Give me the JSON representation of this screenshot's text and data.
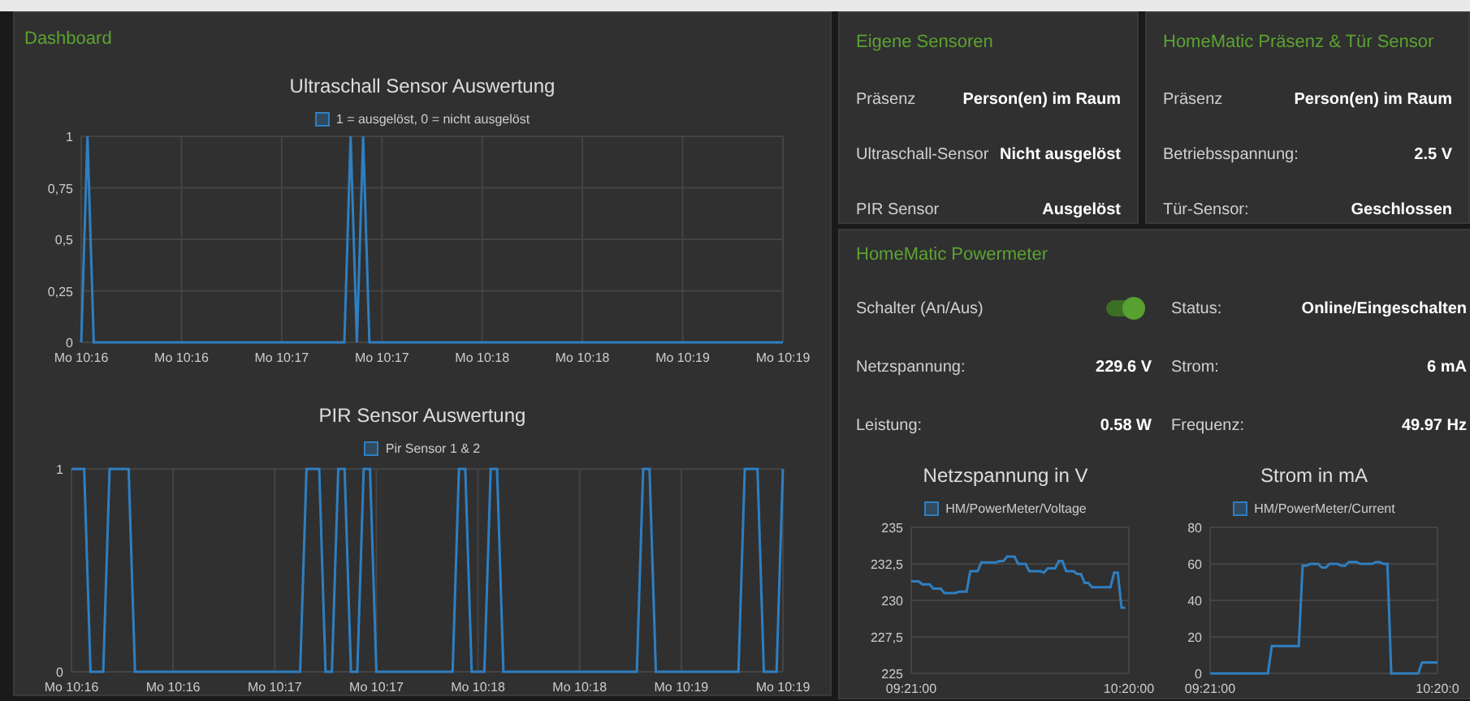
{
  "dashboard": {
    "title": "Dashboard",
    "charts": [
      {
        "chart_data": {
          "type": "line",
          "title": "Ultraschall Sensor Auswertung",
          "grid": true,
          "categories": [
            "Mo 10:16",
            null,
            null,
            null,
            null,
            null,
            null,
            null,
            null,
            null,
            null,
            null,
            null,
            null,
            null,
            null,
            "Mo 10:16",
            null,
            null,
            null,
            null,
            null,
            null,
            null,
            null,
            null,
            null,
            null,
            null,
            null,
            null,
            null,
            "Mo 10:17",
            null,
            null,
            null,
            null,
            null,
            null,
            null,
            null,
            null,
            null,
            null,
            null,
            null,
            null,
            null,
            "Mo 10:17",
            null,
            null,
            null,
            null,
            null,
            null,
            null,
            null,
            null,
            null,
            null,
            null,
            null,
            null,
            null,
            "Mo 10:18",
            null,
            null,
            null,
            null,
            null,
            null,
            null,
            null,
            null,
            null,
            null,
            null,
            null,
            null,
            null,
            "Mo 10:18",
            null,
            null,
            null,
            null,
            null,
            null,
            null,
            null,
            null,
            null,
            null,
            null,
            null,
            null,
            null,
            "Mo 10:19",
            null,
            null,
            null,
            null,
            null,
            null,
            null,
            null,
            null,
            null,
            null,
            null,
            null,
            null,
            null,
            "Mo 10:19"
          ],
          "series": [
            {
              "name": "1 = ausgelöst, 0 = nicht ausgelöst",
              "color": "#2f7fc1",
              "values": [
                0,
                1,
                0,
                0,
                0,
                0,
                0,
                0,
                0,
                0,
                0,
                0,
                0,
                0,
                0,
                0,
                0,
                0,
                0,
                0,
                0,
                0,
                0,
                0,
                0,
                0,
                0,
                0,
                0,
                0,
                0,
                0,
                0,
                0,
                0,
                0,
                0,
                0,
                0,
                0,
                0,
                0,
                0,
                1,
                0,
                1,
                0,
                0,
                0,
                0,
                0,
                0,
                0,
                0,
                0,
                0,
                0,
                0,
                0,
                0,
                0,
                0,
                0,
                0,
                0,
                0,
                0,
                0,
                0,
                0,
                0,
                0,
                0,
                0,
                0,
                0,
                0,
                0,
                0,
                0,
                0,
                0,
                0,
                0,
                0,
                0,
                0,
                0,
                0,
                0,
                0,
                0,
                0,
                0,
                0,
                0,
                0,
                0,
                0,
                0,
                0,
                0,
                0,
                0,
                0,
                0,
                0,
                0,
                0,
                0,
                0,
                0,
                0
              ]
            }
          ],
          "ylim": [
            0,
            1
          ],
          "yticks": [
            {
              "value": 0,
              "label": "0"
            },
            {
              "value": 0.25,
              "label": "0,25"
            },
            {
              "value": 0.5,
              "label": "0,5"
            },
            {
              "value": 0.75,
              "label": "0,75"
            },
            {
              "value": 1,
              "label": "1"
            }
          ]
        }
      },
      {
        "chart_data": {
          "type": "line",
          "title": "PIR Sensor Auswertung",
          "grid": true,
          "categories": [
            "Mo 10:16",
            null,
            null,
            null,
            null,
            null,
            null,
            null,
            null,
            null,
            null,
            null,
            null,
            null,
            null,
            null,
            "Mo 10:16",
            null,
            null,
            null,
            null,
            null,
            null,
            null,
            null,
            null,
            null,
            null,
            null,
            null,
            null,
            null,
            "Mo 10:17",
            null,
            null,
            null,
            null,
            null,
            null,
            null,
            null,
            null,
            null,
            null,
            null,
            null,
            null,
            null,
            "Mo 10:17",
            null,
            null,
            null,
            null,
            null,
            null,
            null,
            null,
            null,
            null,
            null,
            null,
            null,
            null,
            null,
            "Mo 10:18",
            null,
            null,
            null,
            null,
            null,
            null,
            null,
            null,
            null,
            null,
            null,
            null,
            null,
            null,
            null,
            "Mo 10:18",
            null,
            null,
            null,
            null,
            null,
            null,
            null,
            null,
            null,
            null,
            null,
            null,
            null,
            null,
            null,
            "Mo 10:19",
            null,
            null,
            null,
            null,
            null,
            null,
            null,
            null,
            null,
            null,
            null,
            null,
            null,
            null,
            null,
            "Mo 10:19"
          ],
          "series": [
            {
              "name": "Pir Sensor 1 & 2",
              "color": "#2f7fc1",
              "values": [
                1,
                1,
                1,
                0,
                0,
                0,
                1,
                1,
                1,
                1,
                0,
                0,
                0,
                0,
                0,
                0,
                0,
                0,
                0,
                0,
                0,
                0,
                0,
                0,
                0,
                0,
                0,
                0,
                0,
                0,
                0,
                0,
                0,
                0,
                0,
                0,
                0,
                1,
                1,
                1,
                0,
                0,
                1,
                1,
                0,
                0,
                1,
                1,
                0,
                0,
                0,
                0,
                0,
                0,
                0,
                0,
                0,
                0,
                0,
                0,
                0,
                1,
                1,
                0,
                0,
                0,
                1,
                1,
                0,
                0,
                0,
                0,
                0,
                0,
                0,
                0,
                0,
                0,
                0,
                0,
                0,
                0,
                0,
                0,
                0,
                0,
                0,
                0,
                0,
                0,
                1,
                1,
                0,
                0,
                0,
                0,
                0,
                0,
                0,
                0,
                0,
                0,
                0,
                0,
                0,
                0,
                1,
                1,
                1,
                0,
                0,
                0,
                1
              ]
            }
          ],
          "ylim": [
            0,
            1
          ],
          "yticks": [
            {
              "value": 0,
              "label": "0"
            },
            {
              "value": 1,
              "label": "1"
            }
          ]
        }
      }
    ]
  },
  "cards": [
    {
      "title": "Eigene Sensoren",
      "rows": [
        {
          "label": "Präsenz",
          "value": "Person(en) im Raum"
        },
        {
          "label": "Ultraschall-Sensor",
          "value": "Nicht ausgelöst"
        },
        {
          "label": "PIR Sensor",
          "value": "Ausgelöst"
        }
      ]
    },
    {
      "title": "HomeMatic Präsenz & Tür Sensor",
      "rows": [
        {
          "label": "Präsenz",
          "value": "Person(en) im Raum"
        },
        {
          "label": "Betriebsspannung:",
          "value": "2.5 V"
        },
        {
          "label": "Tür-Sensor:",
          "value": "Geschlossen"
        }
      ]
    }
  ],
  "powermeter": {
    "title": "HomeMatic Powermeter",
    "items": [
      {
        "kind": "toggle",
        "label": "Schalter (An/Aus)",
        "on": true
      },
      {
        "kind": "value",
        "label": "Status:",
        "value": "Online/Eingeschalten"
      },
      {
        "kind": "value",
        "label": "Netzspannung:",
        "value": "229.6 V"
      },
      {
        "kind": "value",
        "label": "Strom:",
        "value": "6 mA"
      },
      {
        "kind": "value",
        "label": "Leistung:",
        "value": "0.58 W"
      },
      {
        "kind": "value",
        "label": "Frequenz:",
        "value": "49.97 Hz"
      }
    ],
    "charts": [
      {
        "chart_data": {
          "type": "line",
          "title": "Netzspannung in V",
          "grid": true,
          "categories": [
            "09:21:00",
            null,
            null,
            null,
            null,
            null,
            null,
            null,
            null,
            null,
            null,
            null,
            null,
            null,
            null,
            null,
            null,
            null,
            null,
            null,
            null,
            null,
            null,
            null,
            null,
            null,
            null,
            null,
            null,
            null,
            null,
            null,
            null,
            null,
            null,
            null,
            null,
            null,
            null,
            null,
            null,
            null,
            null,
            null,
            null,
            null,
            null,
            null,
            null,
            null,
            null,
            null,
            null,
            null,
            null,
            null,
            null,
            null,
            null,
            "10:20:00"
          ],
          "series": [
            {
              "name": "HM/PowerMeter/Voltage",
              "color": "#2f7fc1",
              "values": [
                231.3,
                231.3,
                231.3,
                231.1,
                231.1,
                231.1,
                230.8,
                230.8,
                230.8,
                230.5,
                230.5,
                230.5,
                230.5,
                230.6,
                230.6,
                230.6,
                232,
                232,
                232,
                232.6,
                232.6,
                232.6,
                232.6,
                232.6,
                232.7,
                232.7,
                233,
                233,
                233,
                232.5,
                232.5,
                232.5,
                232,
                232,
                232,
                232,
                231.9,
                232.2,
                232.2,
                232.2,
                232.7,
                232.7,
                232,
                232,
                232,
                231.8,
                231.8,
                231.2,
                231.2,
                230.9,
                230.9,
                230.9,
                230.9,
                230.9,
                230.9,
                231.9,
                231.9,
                229.5,
                229.5,
                null
              ]
            }
          ],
          "ylim": [
            225,
            235
          ],
          "yticks": [
            {
              "value": 225,
              "label": "225"
            },
            {
              "value": 227.5,
              "label": "227,5"
            },
            {
              "value": 230,
              "label": "230"
            },
            {
              "value": 232.5,
              "label": "232,5"
            },
            {
              "value": 235,
              "label": "235"
            }
          ]
        }
      },
      {
        "chart_data": {
          "type": "line",
          "title": "Strom in mA",
          "grid": true,
          "categories": [
            "09:21:00",
            null,
            null,
            null,
            null,
            null,
            null,
            null,
            null,
            null,
            null,
            null,
            null,
            null,
            null,
            null,
            null,
            null,
            null,
            null,
            null,
            null,
            null,
            null,
            null,
            null,
            null,
            null,
            null,
            null,
            null,
            null,
            null,
            null,
            null,
            null,
            null,
            null,
            null,
            null,
            null,
            null,
            null,
            null,
            null,
            null,
            null,
            null,
            null,
            null,
            null,
            null,
            null,
            null,
            null,
            null,
            null,
            null,
            null,
            "10:20:0"
          ],
          "series": [
            {
              "name": "HM/PowerMeter/Current",
              "color": "#2f7fc1",
              "values": [
                0,
                0,
                0,
                0,
                0,
                0,
                0,
                0,
                0,
                0,
                0,
                0,
                0,
                0,
                0,
                0,
                15,
                15,
                15,
                15,
                15,
                15,
                15,
                15,
                59,
                59,
                60,
                60,
                60,
                58,
                58,
                60,
                60,
                60,
                59,
                59,
                61,
                61,
                61,
                60,
                60,
                60,
                60,
                61,
                61,
                60,
                60,
                0,
                0,
                0,
                0,
                0,
                0,
                0,
                0,
                6,
                6,
                6,
                6,
                6
              ]
            }
          ],
          "ylim": [
            0,
            80
          ],
          "yticks": [
            {
              "value": 0,
              "label": "0"
            },
            {
              "value": 20,
              "label": "20"
            },
            {
              "value": 40,
              "label": "40"
            },
            {
              "value": 60,
              "label": "60"
            },
            {
              "value": 80,
              "label": "80"
            }
          ]
        }
      }
    ]
  }
}
